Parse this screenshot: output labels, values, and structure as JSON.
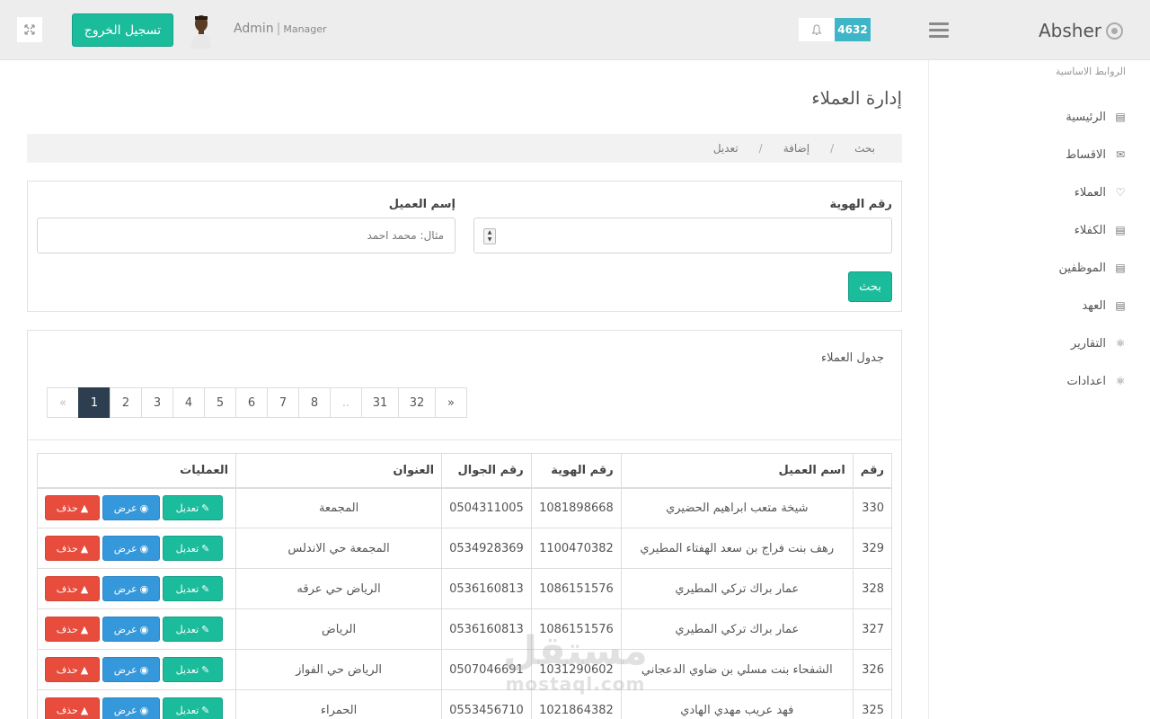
{
  "header": {
    "logout_label": "تسجيل الخروج",
    "user_name": "Admin",
    "user_separator": "|",
    "user_role": "Manager",
    "notification_count": "4632",
    "brand": "Absher"
  },
  "sidebar": {
    "heading": "الروابط الاساسية",
    "items": [
      {
        "label": "الرئيسية",
        "icon": "monitor-icon"
      },
      {
        "label": "الاقساط",
        "icon": "envelope-icon"
      },
      {
        "label": "العملاء",
        "icon": "heart-icon"
      },
      {
        "label": "الكفلاء",
        "icon": "monitor-icon"
      },
      {
        "label": "الموظفين",
        "icon": "monitor-icon"
      },
      {
        "label": "العهد",
        "icon": "monitor-icon"
      },
      {
        "label": "التقارير",
        "icon": "flask-icon"
      },
      {
        "label": "اعدادات",
        "icon": "flask-icon"
      }
    ]
  },
  "main": {
    "page_title": "إدارة العملاء",
    "breadcrumbs": [
      "بحث",
      "إضافة",
      "تعديل"
    ],
    "breadcrumb_separator": "/"
  },
  "search": {
    "id_label": "رقم الهوية",
    "id_value": "",
    "name_label": "إسم العميل",
    "name_placeholder": "مثال: محمد احمد",
    "submit_label": "بحث"
  },
  "table": {
    "title": "جدول العملاء",
    "pagination": {
      "prev": "«",
      "pages": [
        "1",
        "2",
        "3",
        "4",
        "5",
        "6",
        "7",
        "8"
      ],
      "ellipsis": "..",
      "tail_pages": [
        "31",
        "32"
      ],
      "next": "»",
      "active": "1"
    },
    "columns": [
      "رقم",
      "اسم العميل",
      "رقم الهوية",
      "رقم الجوال",
      "العنوان",
      "العمليات"
    ],
    "actions": {
      "edit": "تعديل",
      "view": "عرض",
      "delete": "حذف"
    },
    "rows": [
      {
        "num": "330",
        "name": "شيخة متعب ابراهيم الحضيري",
        "id": "1081898668",
        "phone": "0504311005",
        "address": "المجمعة"
      },
      {
        "num": "329",
        "name": "رهف بنت فراج بن سعد الهفتاء المطيري",
        "id": "1100470382",
        "phone": "0534928369",
        "address": "المجمعة حي الاندلس"
      },
      {
        "num": "328",
        "name": "عمار براك تركي المطيري",
        "id": "1086151576",
        "phone": "0536160813",
        "address": "الرياض حي عرقه"
      },
      {
        "num": "327",
        "name": "عمار براك تركي المطيري",
        "id": "1086151576",
        "phone": "0536160813",
        "address": "الرياض"
      },
      {
        "num": "326",
        "name": "الشفحاء بنت مسلي بن ضاوي الدعجاني",
        "id": "1031290602",
        "phone": "0507046691",
        "address": "الرياض حي الفواز"
      },
      {
        "num": "325",
        "name": "فهد عريب مهدي الهادي",
        "id": "1021864382",
        "phone": "0553456710",
        "address": "الحمراء"
      }
    ]
  },
  "watermark": {
    "line1": "مستقل",
    "line2": "mostaql.com"
  },
  "colors": {
    "primary": "#1abc9c",
    "info": "#3498db",
    "danger": "#e74c3c",
    "badge": "#3fb6c8",
    "pager_active": "#2c3e50"
  }
}
